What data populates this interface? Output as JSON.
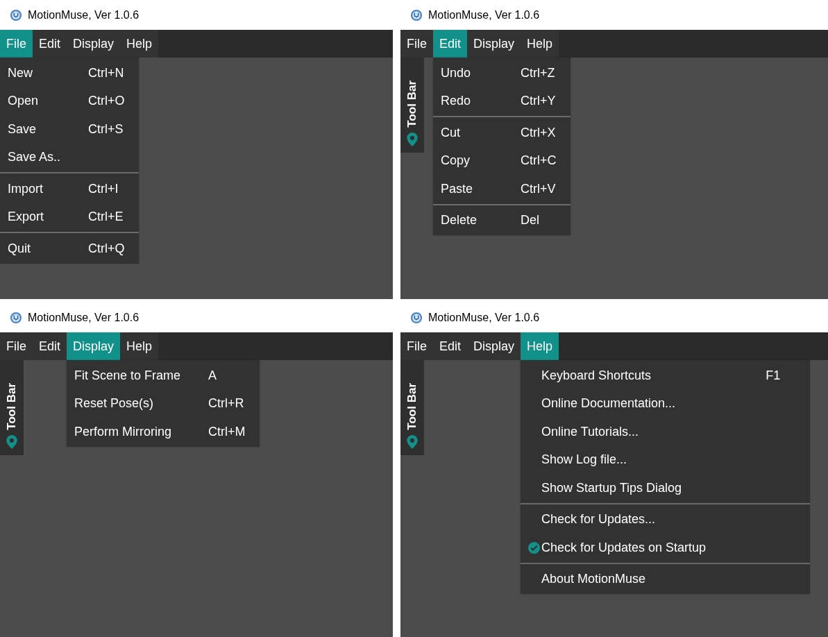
{
  "panels": [
    {
      "title": "MotionMuse, Ver 1.0.6",
      "menu_bar": [
        {
          "label": "File",
          "selected": true
        },
        {
          "label": "Edit",
          "selected": false
        },
        {
          "label": "Display",
          "selected": false
        },
        {
          "label": "Help",
          "selected": false
        }
      ],
      "menu": {
        "items": [
          {
            "kind": "item",
            "label": "New",
            "shortcut": "Ctrl+N"
          },
          {
            "kind": "item",
            "label": "Open",
            "shortcut": "Ctrl+O"
          },
          {
            "kind": "item",
            "label": "Save",
            "shortcut": "Ctrl+S"
          },
          {
            "kind": "item",
            "label": "Save As.."
          },
          {
            "kind": "separator"
          },
          {
            "kind": "item",
            "label": "Import",
            "shortcut": "Ctrl+I"
          },
          {
            "kind": "item",
            "label": "Export",
            "shortcut": "Ctrl+E"
          },
          {
            "kind": "separator"
          },
          {
            "kind": "item",
            "label": "Quit",
            "shortcut": "Ctrl+Q"
          }
        ]
      }
    },
    {
      "title": "MotionMuse, Ver 1.0.6",
      "menu_bar": [
        {
          "label": "File",
          "selected": false
        },
        {
          "label": "Edit",
          "selected": true
        },
        {
          "label": "Display",
          "selected": false
        },
        {
          "label": "Help",
          "selected": false
        }
      ],
      "toolbar": {
        "label": "Tool Bar"
      },
      "menu": {
        "items": [
          {
            "kind": "item",
            "label": "Undo",
            "shortcut": "Ctrl+Z"
          },
          {
            "kind": "item",
            "label": "Redo",
            "shortcut": "Ctrl+Y"
          },
          {
            "kind": "separator"
          },
          {
            "kind": "item",
            "label": "Cut",
            "shortcut": "Ctrl+X"
          },
          {
            "kind": "item",
            "label": "Copy",
            "shortcut": "Ctrl+C"
          },
          {
            "kind": "item",
            "label": "Paste",
            "shortcut": "Ctrl+V"
          },
          {
            "kind": "separator"
          },
          {
            "kind": "item",
            "label": "Delete",
            "shortcut": "Del"
          }
        ]
      }
    },
    {
      "title": "MotionMuse, Ver 1.0.6",
      "menu_bar": [
        {
          "label": "File",
          "selected": false
        },
        {
          "label": "Edit",
          "selected": false
        },
        {
          "label": "Display",
          "selected": true
        },
        {
          "label": "Help",
          "selected": false
        }
      ],
      "toolbar": {
        "label": "Tool Bar"
      },
      "menu": {
        "items": [
          {
            "kind": "item",
            "label": "Fit Scene to Frame",
            "shortcut": "A"
          },
          {
            "kind": "item",
            "label": "Reset Pose(s)",
            "shortcut": "Ctrl+R"
          },
          {
            "kind": "item",
            "label": "Perform Mirroring",
            "shortcut": "Ctrl+M"
          }
        ]
      }
    },
    {
      "title": "MotionMuse, Ver 1.0.6",
      "menu_bar": [
        {
          "label": "File",
          "selected": false
        },
        {
          "label": "Edit",
          "selected": false
        },
        {
          "label": "Display",
          "selected": false
        },
        {
          "label": "Help",
          "selected": true
        }
      ],
      "toolbar": {
        "label": "Tool Bar"
      },
      "menu": {
        "items": [
          {
            "kind": "item",
            "label": "Keyboard Shortcuts",
            "shortcut": "F1"
          },
          {
            "kind": "item",
            "label": "Online Documentation..."
          },
          {
            "kind": "item",
            "label": "Online Tutorials..."
          },
          {
            "kind": "item",
            "label": "Show Log file..."
          },
          {
            "kind": "item",
            "label": "Show Startup Tips Dialog"
          },
          {
            "kind": "separator"
          },
          {
            "kind": "item",
            "label": "Check for Updates..."
          },
          {
            "kind": "check",
            "label": "Check for Updates on Startup",
            "checked": true
          },
          {
            "kind": "separator"
          },
          {
            "kind": "item",
            "label": "About MotionMuse"
          }
        ]
      }
    }
  ]
}
